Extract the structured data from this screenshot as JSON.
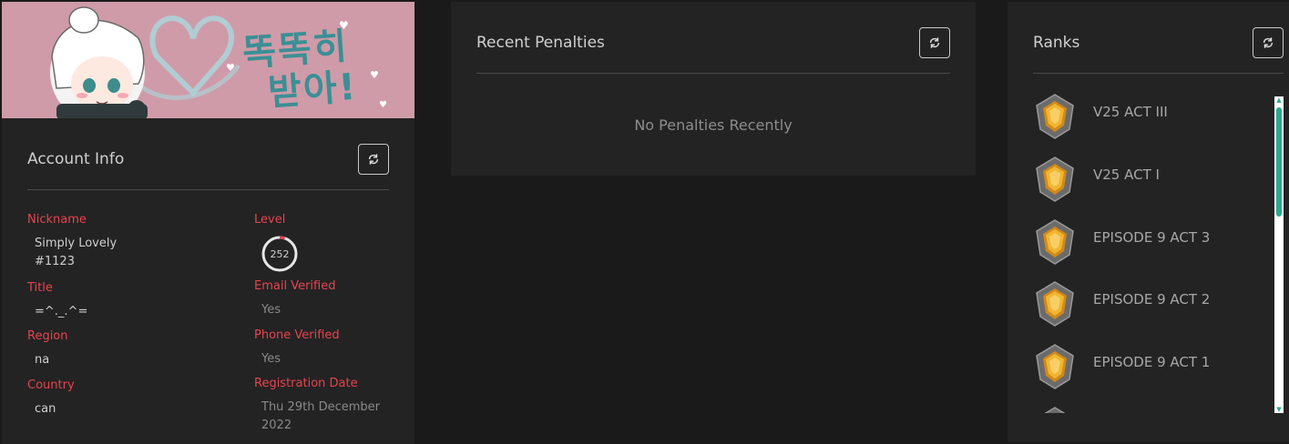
{
  "account": {
    "banner": {
      "line1": "똑똑히",
      "line2": "받아!"
    },
    "title": "Account Info",
    "fields": {
      "nickname_label": "Nickname",
      "nickname_value": "Simply Lovely",
      "nickname_tag": "#1123",
      "title_label": "Title",
      "title_value": "=^._.^=",
      "region_label": "Region",
      "region_value": "na",
      "country_label": "Country",
      "country_value": "can",
      "level_label": "Level",
      "level_value": "252",
      "email_label": "Email Verified",
      "email_value": "Yes",
      "phone_label": "Phone Verified",
      "phone_value": "Yes",
      "registration_label": "Registration Date",
      "registration_line1": "Thu 29th December",
      "registration_line2": "2022"
    },
    "level_progress": 0.05
  },
  "penalties": {
    "title": "Recent Penalties",
    "empty_message": "No Penalties Recently"
  },
  "ranks": {
    "title": "Ranks",
    "items": [
      {
        "label": "V25 ACT III",
        "icon": "gold-rank-icon"
      },
      {
        "label": "V25 ACT I",
        "icon": "gold-rank-icon"
      },
      {
        "label": "EPISODE 9 ACT 3",
        "icon": "gold-rank-icon"
      },
      {
        "label": "EPISODE 9 ACT 2",
        "icon": "gold-rank-icon"
      },
      {
        "label": "EPISODE 9 ACT 1",
        "icon": "gold-rank-icon"
      }
    ]
  },
  "colors": {
    "accent_red": "#e8434f",
    "scroll_accent": "#2aa98f",
    "card_bg": "#232323",
    "page_bg": "#1a1a1a"
  }
}
